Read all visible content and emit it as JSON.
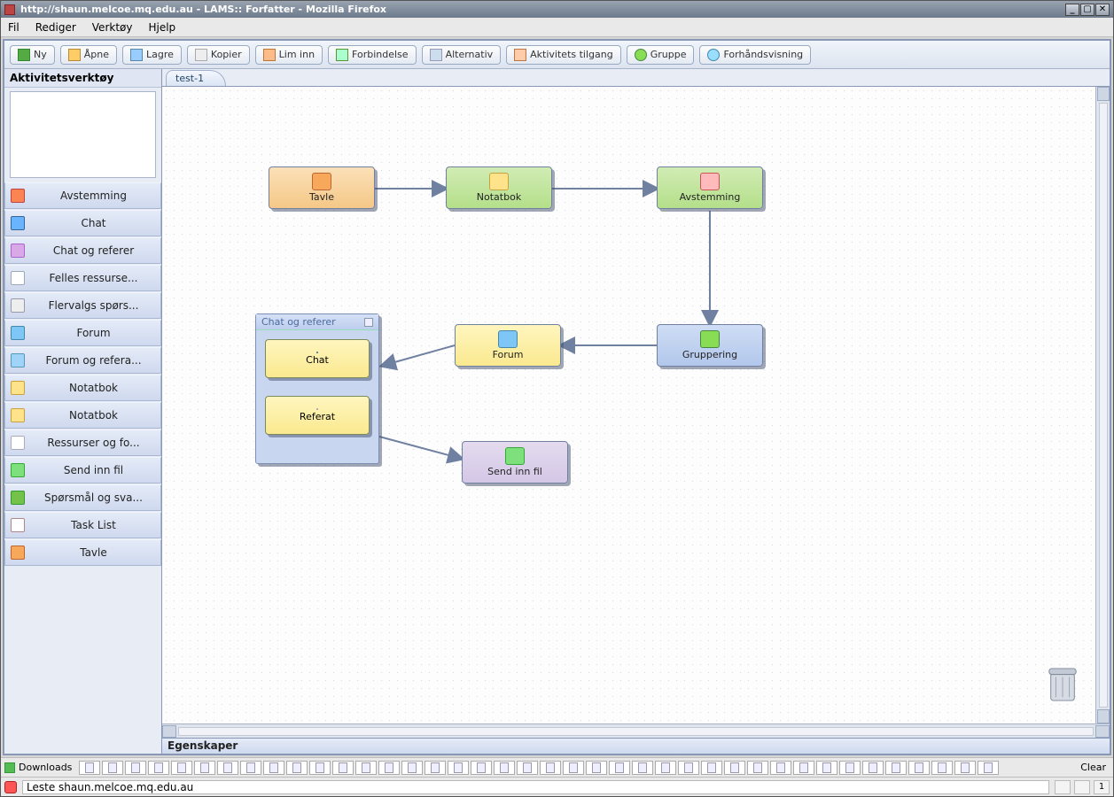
{
  "window": {
    "title": "http://shaun.melcoe.mq.edu.au - LAMS:: Forfatter - Mozilla Firefox"
  },
  "menubar": [
    "Fil",
    "Rediger",
    "Verktøy",
    "Hjelp"
  ],
  "toolbar": [
    {
      "id": "new",
      "label": "Ny"
    },
    {
      "id": "open",
      "label": "Åpne"
    },
    {
      "id": "save",
      "label": "Lagre"
    },
    {
      "id": "copy",
      "label": "Kopier"
    },
    {
      "id": "paste",
      "label": "Lim inn"
    },
    {
      "id": "transition",
      "label": "Forbindelse"
    },
    {
      "id": "optional",
      "label": "Alternativ"
    },
    {
      "id": "gate",
      "label": "Aktivitets tilgang"
    },
    {
      "id": "group",
      "label": "Gruppe"
    },
    {
      "id": "preview",
      "label": "Forhåndsvisning"
    }
  ],
  "sidebar": {
    "title": "Aktivitetsverktøy",
    "items": [
      {
        "id": "vote",
        "label": "Avstemming"
      },
      {
        "id": "chat",
        "label": "Chat"
      },
      {
        "id": "chatref",
        "label": "Chat og referer"
      },
      {
        "id": "share",
        "label": "Felles ressurse..."
      },
      {
        "id": "mc",
        "label": "Flervalgs spørs..."
      },
      {
        "id": "forum",
        "label": "Forum"
      },
      {
        "id": "forumref",
        "label": "Forum og refera..."
      },
      {
        "id": "nb1",
        "label": "Notatbok"
      },
      {
        "id": "nb2",
        "label": "Notatbok"
      },
      {
        "id": "res",
        "label": "Ressurser og fo..."
      },
      {
        "id": "submit",
        "label": "Send inn fil"
      },
      {
        "id": "qa",
        "label": "Spørsmål og sva..."
      },
      {
        "id": "task",
        "label": "Task List"
      },
      {
        "id": "scribe",
        "label": "Tavle"
      }
    ]
  },
  "tab": "test-1",
  "nodes": {
    "tavle": "Tavle",
    "notatbok": "Notatbok",
    "avstemming": "Avstemming",
    "gruppering": "Gruppering",
    "forum": "Forum",
    "container_title": "Chat og referer",
    "chat": "Chat",
    "referat": "Referat",
    "sendinn": "Send inn fil"
  },
  "properties": "Egenskaper",
  "downloads_label": "Downloads",
  "downloads_clear": "Clear",
  "status": {
    "text": "Leste shaun.melcoe.mq.edu.au",
    "count": "1"
  }
}
